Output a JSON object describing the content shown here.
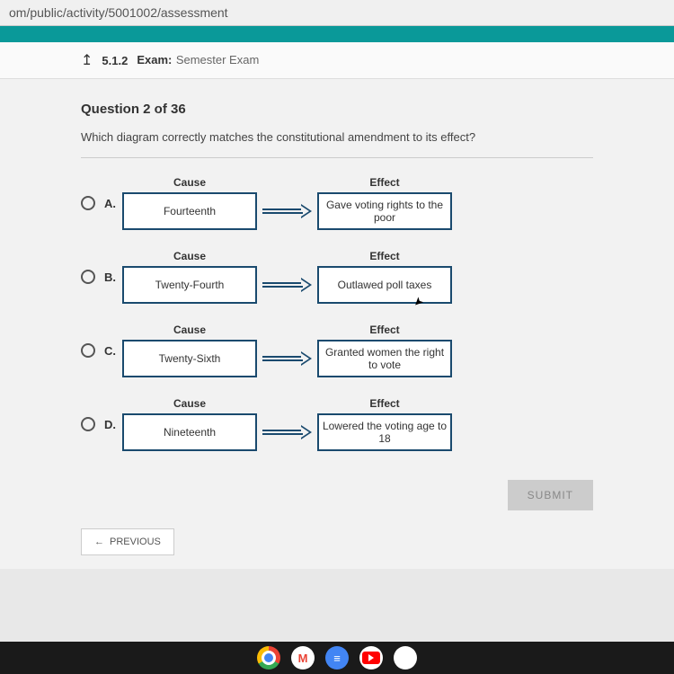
{
  "url": "om/public/activity/5001002/assessment",
  "header": {
    "number": "5.1.2",
    "exam_label": "Exam:",
    "exam_name": "Semester Exam"
  },
  "question": {
    "counter": "Question 2 of 36",
    "prompt": "Which diagram correctly matches the constitutional amendment to its effect?"
  },
  "labels": {
    "cause": "Cause",
    "effect": "Effect"
  },
  "options": {
    "a": {
      "letter": "A.",
      "cause": "Fourteenth",
      "effect": "Gave voting rights to the poor"
    },
    "b": {
      "letter": "B.",
      "cause": "Twenty-Fourth",
      "effect": "Outlawed poll taxes"
    },
    "c": {
      "letter": "C.",
      "cause": "Twenty-Sixth",
      "effect": "Granted women the right to vote"
    },
    "d": {
      "letter": "D.",
      "cause": "Nineteenth",
      "effect": "Lowered the voting age to 18"
    }
  },
  "buttons": {
    "submit": "SUBMIT",
    "previous": "PREVIOUS"
  }
}
